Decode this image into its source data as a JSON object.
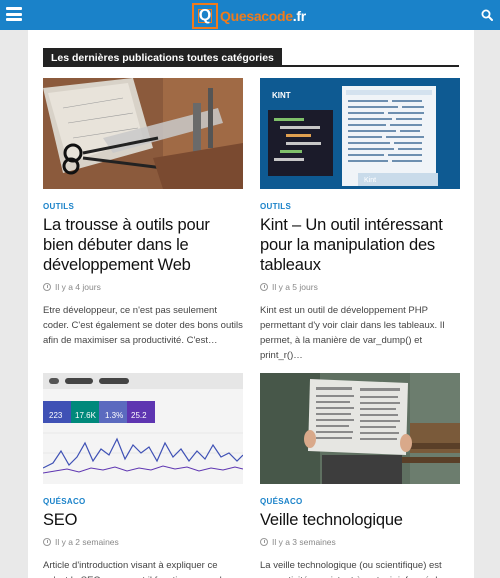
{
  "header": {
    "logo_mark": "Q",
    "logo_text_main": "Quesacode",
    "logo_text_tld": ".fr",
    "menu_icon": "hamburger-menu-icon",
    "search_icon": "search-icon",
    "bar_color": "#1a82c9",
    "accent_color": "#f07b1a"
  },
  "section": {
    "label": "Les dernières publications toutes catégories"
  },
  "posts": [
    {
      "category": "OUTILS",
      "title": "La trousse à outils pour bien débuter dans le développement Web",
      "date": "Il y a 4 jours",
      "excerpt": "Etre développeur, ce n'est pas seulement coder. C'est également se doter des bons outils afin de maximiser sa productivité. C'est…"
    },
    {
      "category": "OUTILS",
      "title": "Kint – Un outil intéressant pour la manipulation des tableaux",
      "date": "Il y a 5 jours",
      "excerpt": "Kint est un outil de développement PHP permettant d'y voir clair dans les tableaux. Il permet, à la manière de var_dump() et print_r()…",
      "image_text": {
        "heading": "KINT",
        "badge": "Kint"
      }
    },
    {
      "category": "QUÉSACO",
      "title": "SEO",
      "date": "Il y a 2 semaines",
      "excerpt": "Article d'introduction visant à expliquer ce qu'est le SEO, comment il fonctionne, quel",
      "image_text": {
        "stat1": "223",
        "stat2": "17.6K",
        "stat3": "1.3%",
        "stat4": "25.2"
      }
    },
    {
      "category": "QUÉSACO",
      "title": "Veille technologique",
      "date": "Il y a 3 semaines",
      "excerpt": "La veille technologique (ou scientifique) est une activité consistant à se tenir informé des"
    }
  ]
}
